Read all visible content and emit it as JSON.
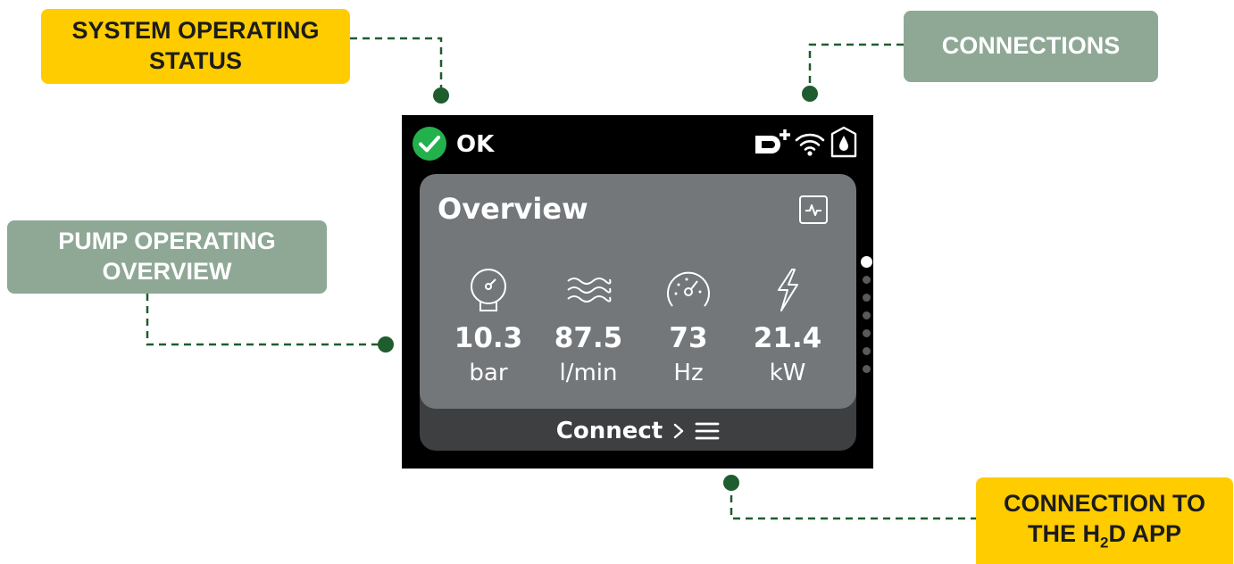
{
  "callouts": {
    "system_status": {
      "line1": "SYSTEM OPERATING",
      "line2": "STATUS"
    },
    "connections": {
      "label": "CONNECTIONS"
    },
    "pump_overview": {
      "line1": "PUMP OPERATING",
      "line2": "OVERVIEW"
    },
    "h2d_app": {
      "line1": "CONNECTION TO",
      "line2_prefix": "THE H",
      "line2_sub": "2",
      "line2_suffix": "D APP"
    }
  },
  "device": {
    "status": {
      "text": "OK",
      "icon": "check-circle-icon",
      "color": "#22b14c"
    },
    "connection_icons": [
      "dab-dconnect-plus-icon",
      "wifi-icon",
      "water-drop-icon"
    ],
    "overview": {
      "title": "Overview",
      "chart_icon": "activity-chart-icon",
      "metrics": [
        {
          "icon": "pressure-gauge-icon",
          "value": "10.3",
          "unit": "bar"
        },
        {
          "icon": "flow-waves-icon",
          "value": "87.5",
          "unit": "l/min"
        },
        {
          "icon": "speedometer-icon",
          "value": "73",
          "unit": "Hz"
        },
        {
          "icon": "lightning-icon",
          "value": "21.4",
          "unit": "kW"
        }
      ]
    },
    "connect": {
      "label": "Connect",
      "icons": [
        "chevron-right-icon",
        "menu-icon"
      ]
    },
    "pager": {
      "pages": 7,
      "active": 1
    }
  },
  "colors": {
    "callout_yellow": "#ffcc00",
    "callout_green": "#8fa896",
    "leader_line": "#1f5c2e",
    "device_bg": "#000000",
    "card_bg": "#74777a",
    "connect_bg": "#3d3f41"
  }
}
